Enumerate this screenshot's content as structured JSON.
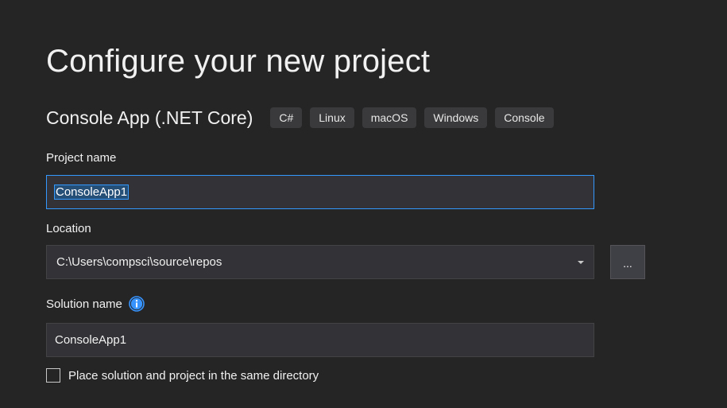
{
  "page": {
    "title": "Configure your new project"
  },
  "template": {
    "name": "Console App (.NET Core)",
    "tags": [
      "C#",
      "Linux",
      "macOS",
      "Windows",
      "Console"
    ]
  },
  "project_name": {
    "label": "Project name",
    "value": "ConsoleApp1",
    "selected": true
  },
  "location": {
    "label": "Location",
    "value": "C:\\Users\\compsci\\source\\repos",
    "browse_label": "..."
  },
  "solution_name": {
    "label": "Solution name",
    "value": "ConsoleApp1",
    "info_icon": "info-icon"
  },
  "same_directory": {
    "label": "Place solution and project in the same directory",
    "checked": false
  },
  "colors": {
    "background": "#252526",
    "input_background": "#333337",
    "focus_border": "#3399ff",
    "selection": "#264f78",
    "tag_background": "#3a3a3c",
    "info_icon": "#3794ff"
  }
}
